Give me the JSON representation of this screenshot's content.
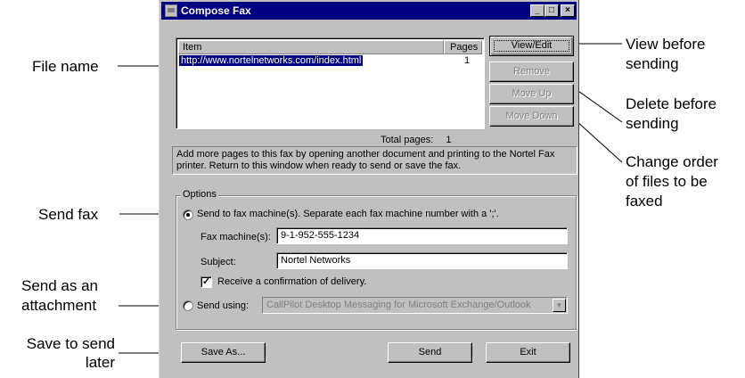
{
  "window": {
    "title": "Compose Fax",
    "controls": {
      "minimize": "_",
      "maximize": "□",
      "close": "×"
    }
  },
  "file_list": {
    "columns": [
      "Item",
      "Pages"
    ],
    "rows": [
      {
        "item": "http://www.nortelnetworks.com/index.html",
        "pages": "1"
      }
    ],
    "total_pages_label": "Total pages:",
    "total_pages": "1"
  },
  "side_buttons": {
    "view_edit": "View/Edit",
    "remove": "Remove",
    "move_up": "Move Up",
    "move_down": "Move Down"
  },
  "info_text": "Add more pages to this fax by opening another document and printing to the Nortel Fax printer.  Return to this window when ready to send or save the fax.",
  "options": {
    "group_label": "Options",
    "send_to_fax_label": "Send to fax machine(s). Separate each fax machine number with a ';'.",
    "fax_machines_label": "Fax machine(s):",
    "fax_machines_value": "9-1-952-555-1234",
    "subject_label": "Subject:",
    "subject_value": "Nortel Networks",
    "confirm_label": "Receive a confirmation of delivery.",
    "send_using_label": "Send using:",
    "send_using_value": "CallPilot Desktop Messaging for Microsoft Exchange/Outlook"
  },
  "bottom_buttons": {
    "save_as": "Save As...",
    "send": "Send",
    "exit": "Exit"
  },
  "callouts": {
    "file_name": "File name",
    "send_fax": "Send fax",
    "send_attachment_1": "Send as an",
    "send_attachment_2": "attachment",
    "save_later_1": "Save to send",
    "save_later_2": "later",
    "view_before_1": "View before",
    "view_before_2": "sending",
    "delete_before_1": "Delete before",
    "delete_before_2": "sending",
    "change_order_1": "Change order",
    "change_order_2": "of files to be",
    "change_order_3": "faxed"
  }
}
